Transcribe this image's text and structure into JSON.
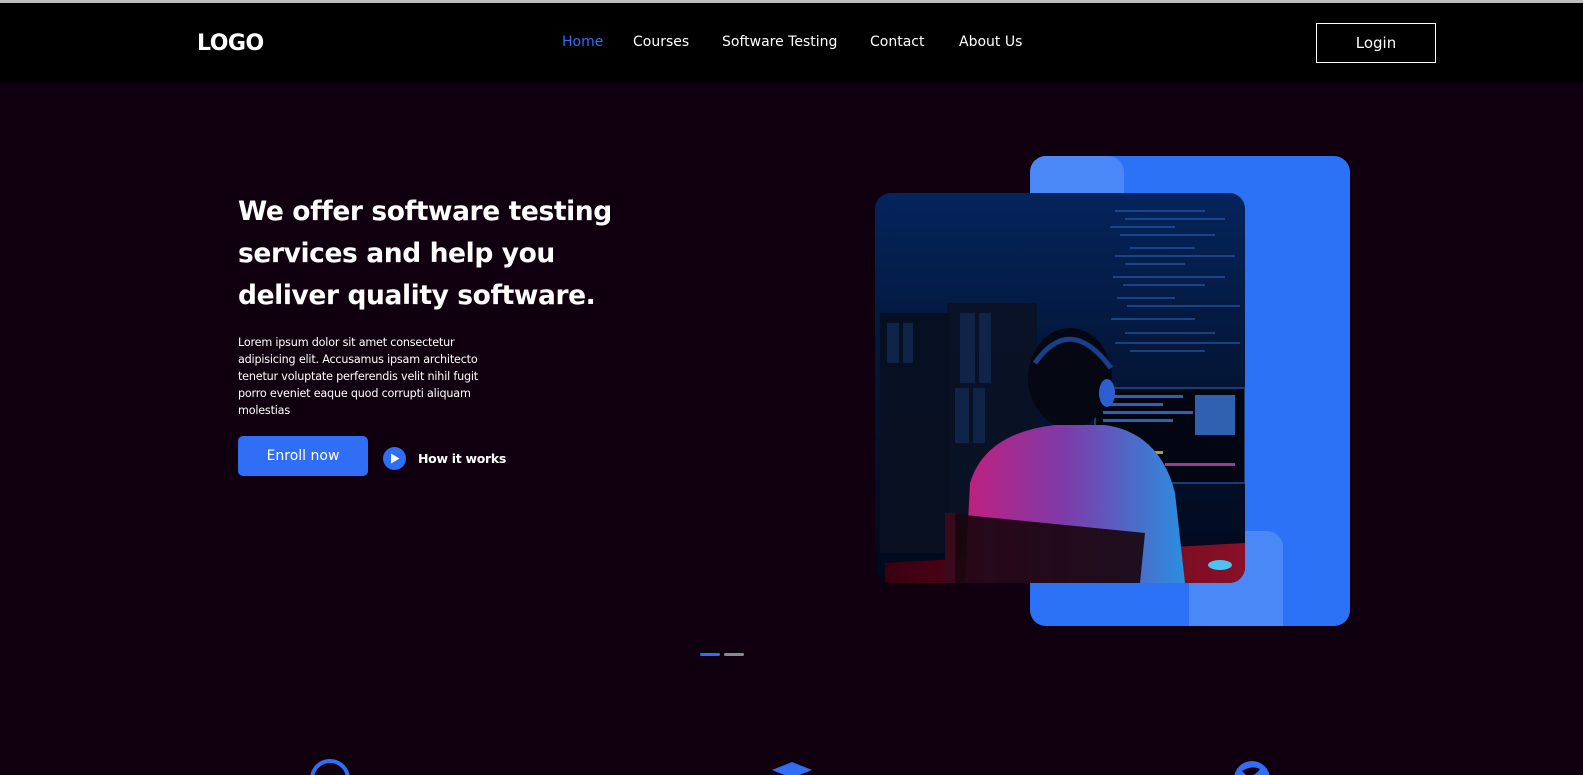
{
  "colors": {
    "accent": "#2f6ef5",
    "background": "#10000f",
    "navbar": "#000000",
    "panel": "#2b72f6",
    "panel_tab": "#4a88f7"
  },
  "navbar": {
    "logo": "LOGO",
    "links": [
      {
        "label": "Home",
        "active": true
      },
      {
        "label": "Courses",
        "active": false
      },
      {
        "label": "Software Testing",
        "active": false
      },
      {
        "label": "Contact",
        "active": false
      },
      {
        "label": "About Us",
        "active": false
      }
    ],
    "login_label": "Login"
  },
  "hero": {
    "title": "We offer software testing services and help you deliver quality software.",
    "description": "Lorem ipsum dolor sit amet consectetur adipisicing elit. Accusamus ipsam architecto tenetur voluptate perferendis velit nihil fugit porro eveniet eaque quod corrupti aliquam molestias",
    "enroll_label": "Enroll now",
    "how_it_works_label": "How it works",
    "play_icon": "play-icon",
    "image": "developer-at-computer-photo"
  },
  "slider": {
    "active_index": 0,
    "count": 2
  },
  "features": {
    "icons": [
      "circle-icon",
      "graduation-cap-icon",
      "globe-icon"
    ]
  }
}
